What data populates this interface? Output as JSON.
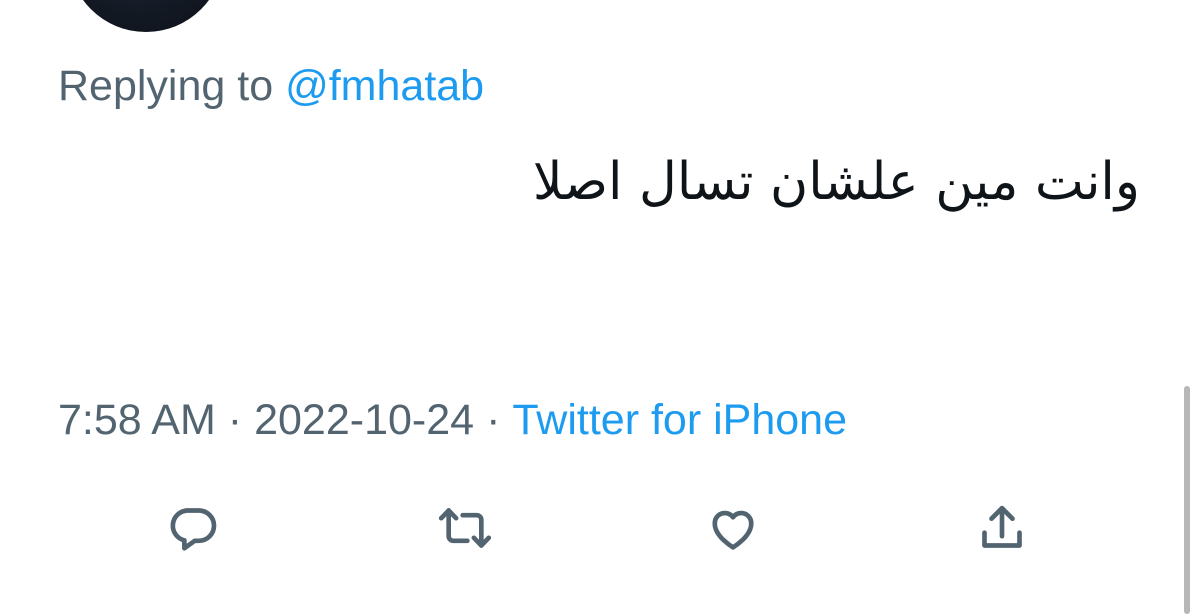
{
  "replying": {
    "prefix": "Replying to ",
    "handle": "@fmhatab"
  },
  "tweet": {
    "text": "وانت مين علشان تسال اصلا"
  },
  "meta": {
    "time": "7:58 AM",
    "separator": "·",
    "date": "2022-10-24",
    "source": "Twitter for iPhone"
  },
  "actions": {
    "icons": [
      "reply-icon",
      "retweet-icon",
      "like-icon",
      "share-icon"
    ]
  },
  "colors": {
    "accent": "#1d9bf0",
    "secondary_text": "#536471",
    "primary_text": "#0f1419"
  }
}
